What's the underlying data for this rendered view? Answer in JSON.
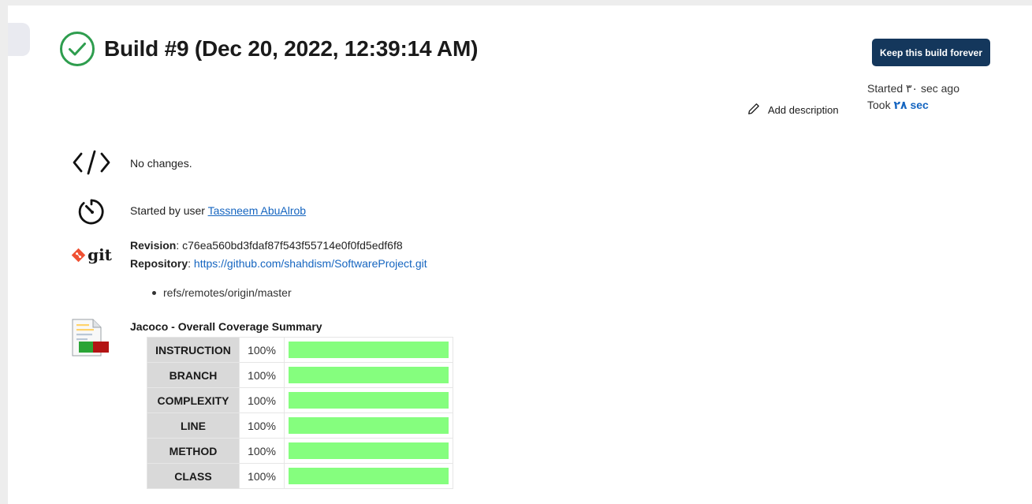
{
  "header": {
    "title": "Build #9 (Dec 20, 2022, 12:39:14 AM)",
    "status_icon": "success-check-circle-icon",
    "keep_button_label": "Keep this build forever",
    "started_text": "Started ٣٠ sec ago",
    "took_prefix": "Took ",
    "took_value": "٢٨ sec",
    "add_description_label": "Add description",
    "add_description_icon": "pencil-icon"
  },
  "changes": {
    "icon": "code-icon",
    "text": "No changes."
  },
  "cause": {
    "icon": "timer-icon",
    "prefix": "Started by user ",
    "user": "Tassneem AbuAlrob"
  },
  "git": {
    "icon": "git-logo-icon",
    "logo_text": "git",
    "revision_label": "Revision",
    "revision_value": ": c76ea560bd3fdaf87f543f55714e0f0fd5edf6f8",
    "repository_label": "Repository",
    "repository_sep": ": ",
    "repository_url": "https://github.com/shahdism/SoftwareProject.git",
    "branches": [
      "refs/remotes/origin/master"
    ]
  },
  "jacoco": {
    "icon": "coverage-report-icon",
    "title": "Jacoco - Overall Coverage Summary",
    "rows": [
      {
        "metric": "INSTRUCTION",
        "percent": "100%",
        "fill": 1.0
      },
      {
        "metric": "BRANCH",
        "percent": "100%",
        "fill": 1.0
      },
      {
        "metric": "COMPLEXITY",
        "percent": "100%",
        "fill": 1.0
      },
      {
        "metric": "LINE",
        "percent": "100%",
        "fill": 1.0
      },
      {
        "metric": "METHOD",
        "percent": "100%",
        "fill": 1.0
      },
      {
        "metric": "CLASS",
        "percent": "100%",
        "fill": 1.0
      }
    ]
  },
  "colors": {
    "success": "#2e9d4e",
    "primary_button": "#14375c",
    "link": "#1565c0",
    "coverage_bar": "#85fe7e",
    "git_orange": "#f05133"
  }
}
